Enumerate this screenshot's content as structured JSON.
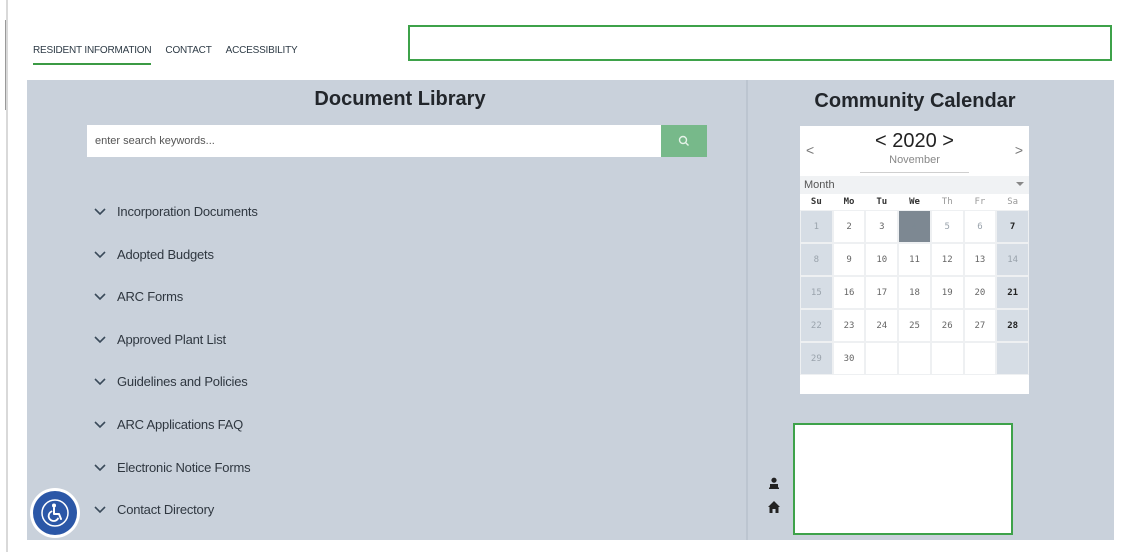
{
  "nav": {
    "items": [
      {
        "label": "RESIDENT INFORMATION"
      },
      {
        "label": "CONTACT"
      },
      {
        "label": "ACCESSIBILITY"
      }
    ]
  },
  "library": {
    "title": "Document Library",
    "search_placeholder": "enter search keywords...",
    "items": [
      {
        "label": "Incorporation Documents"
      },
      {
        "label": "Adopted Budgets"
      },
      {
        "label": "ARC Forms"
      },
      {
        "label": "Approved Plant List"
      },
      {
        "label": "Guidelines and Policies"
      },
      {
        "label": "ARC Applications FAQ"
      },
      {
        "label": "Electronic Notice Forms"
      },
      {
        "label": "Contact Directory"
      }
    ]
  },
  "calendar": {
    "title": "Community Calendar",
    "prev": "<",
    "next": ">",
    "year_label": "< 2020 >",
    "month": "November",
    "view": "Month",
    "weekdays": [
      "Su",
      "Mo",
      "Tu",
      "We",
      "Th",
      "Fr",
      "Sa"
    ],
    "weeks": [
      [
        "1",
        "2",
        "3",
        "4",
        "5",
        "6",
        "7"
      ],
      [
        "8",
        "9",
        "10",
        "11",
        "12",
        "13",
        "14"
      ],
      [
        "15",
        "16",
        "17",
        "18",
        "19",
        "20",
        "21"
      ],
      [
        "22",
        "23",
        "24",
        "25",
        "26",
        "27",
        "28"
      ],
      [
        "29",
        "30",
        "",
        "",
        "",
        "",
        ""
      ]
    ],
    "today": "4"
  },
  "colors": {
    "accent_green": "#3ea24a",
    "panel_bg": "#c9d1db",
    "search_button": "#77b98a",
    "accessibility_blue": "#2b57a7"
  },
  "icons": {
    "search": "search-icon",
    "chevron": "chevron-down-icon",
    "user": "user-icon",
    "home": "home-icon",
    "accessibility": "wheelchair-icon"
  }
}
